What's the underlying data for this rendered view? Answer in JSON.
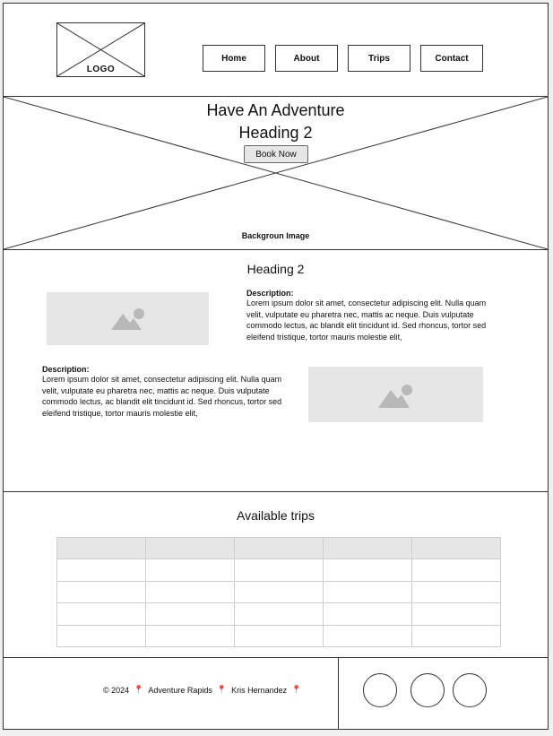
{
  "header": {
    "logo_label": "LOGO",
    "nav": [
      {
        "label": "Home"
      },
      {
        "label": "About"
      },
      {
        "label": "Trips"
      },
      {
        "label": "Contact"
      }
    ]
  },
  "hero": {
    "title": "Have An Adventure",
    "subtitle": "Heading 2",
    "cta_label": "Book Now",
    "background_label": "Backgroun Image"
  },
  "content": {
    "heading": "Heading 2",
    "blocks": [
      {
        "title": "Description:",
        "body": "Lorem ipsum dolor sit amet, consectetur adipiscing elit. Nulla quam velit, vulputate eu pharetra nec, mattis ac neque. Duis vulputate commodo lectus, ac blandit elit tincidunt id. Sed rhoncus, tortor sed eleifend tristique, tortor mauris molestie elit,"
      },
      {
        "title": "Description:",
        "body": "Lorem ipsum dolor sit amet, consectetur adipiscing elit. Nulla quam velit, vulputate eu pharetra nec, mattis ac neque. Duis vulputate commodo lectus, ac blandit elit tincidunt id. Sed rhoncus, tortor sed eleifend tristique, tortor mauris molestie elit,"
      }
    ]
  },
  "trips": {
    "heading": "Available trips",
    "columns": 5,
    "rows": 4
  },
  "footer": {
    "copyright": "© 2024",
    "company": "Adventure Rapids",
    "author": "Kris Hernandez",
    "pin_icon": "pin-icon"
  },
  "colors": {
    "placeholder": "#e6e6e6",
    "stroke": "#333333",
    "pin": "#d35a3a"
  }
}
